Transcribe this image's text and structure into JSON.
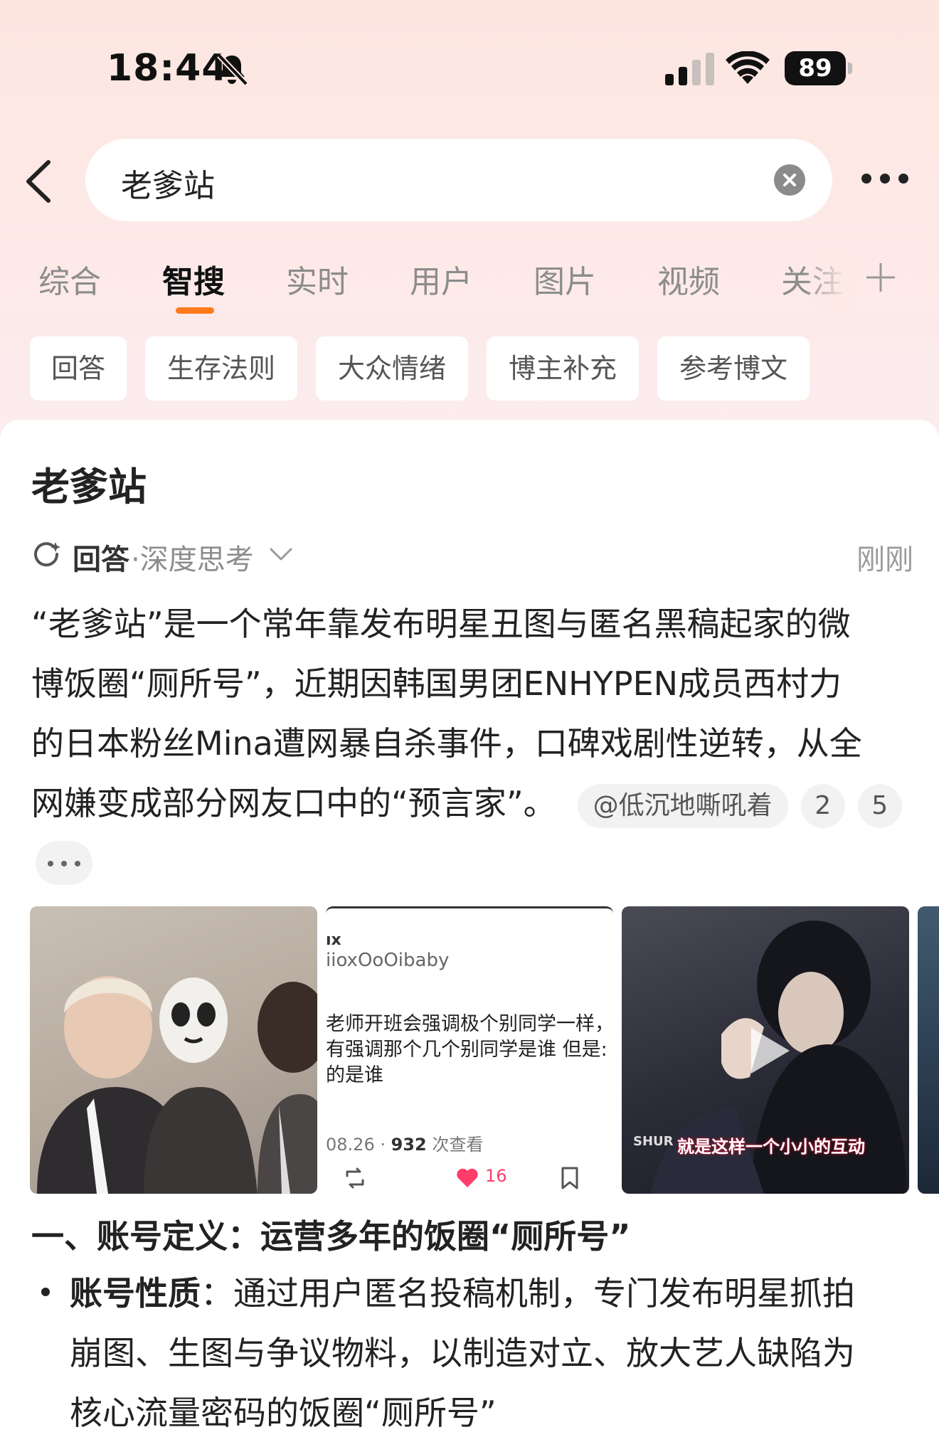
{
  "status_bar": {
    "time": "18:44",
    "battery": "89"
  },
  "search": {
    "query": "老爹站"
  },
  "tabs": [
    {
      "label": "综合",
      "active": false
    },
    {
      "label": "智搜",
      "active": true
    },
    {
      "label": "实时",
      "active": false
    },
    {
      "label": "用户",
      "active": false
    },
    {
      "label": "图片",
      "active": false
    },
    {
      "label": "视频",
      "active": false
    },
    {
      "label": "关注",
      "active": false
    }
  ],
  "chips": [
    "回答",
    "生存法则",
    "大众情绪",
    "博主补充",
    "参考博文"
  ],
  "answer": {
    "title": "老爹站",
    "label": "回答",
    "mode": "·深度思考",
    "time": "刚刚",
    "paragraph_lines": [
      "“老爹站”是一个常年靠发布明星丑图与匿名黑稿起家的微",
      "博饭圈“厕所号”，近期因韩国男团ENHYPEN成员西村力",
      "的日本粉丝Mina遭网暴自杀事件，口碑戏剧性逆转，从全",
      "网嫌变成部分网友口中的“预言家”。"
    ],
    "mention": "@低沉地嘶吼着",
    "refs": [
      "2",
      "5"
    ]
  },
  "thumb_post": {
    "user_line1": "ıx",
    "user_line2": "iioxOoOibaby",
    "lines": [
      "老师开班会强调极个别同学一样，",
      "有强调那个几个别同学是谁 但是:",
      "的是谁"
    ],
    "date": "08.26",
    "views": "932",
    "views_suffix": "次查看",
    "likes": "16"
  },
  "thumb_video": {
    "caption": "就是这样一个小小的互动",
    "logo": "SHUR"
  },
  "section": {
    "heading": "一、账号定义：运营多年的饭圈“厕所号”",
    "bullet_label": "账号性质",
    "bullet_lines": [
      "：通过用户匿名投稿机制，专门发布明星抓拍",
      "崩图、生图与争议物料，以制造对立、放大艺人缺陷为",
      "核心流量密码的饭圈“厕所号”"
    ]
  },
  "colors": {
    "accent": "#ff7a1a",
    "like": "#ff3d6b"
  }
}
